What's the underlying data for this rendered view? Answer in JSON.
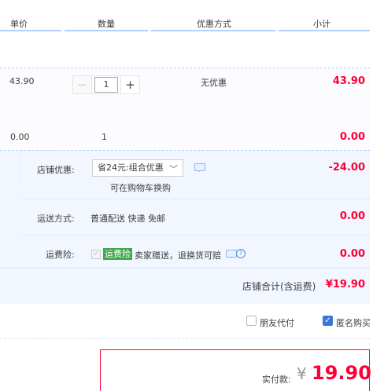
{
  "header": {
    "unit_price": "单价",
    "quantity": "数量",
    "discount": "优惠方式",
    "subtotal": "小计"
  },
  "item": {
    "price": "43.90",
    "quantity_value": "1",
    "discount_text": "无优惠",
    "subtotal": "43.90"
  },
  "row2": {
    "price": "0.00",
    "quantity": "1",
    "subtotal": "0.00"
  },
  "shop": {
    "coupon_label": "店铺优惠:",
    "coupon_select": "省24元:组合优惠",
    "coupon_hint": "可在购物车换购",
    "coupon_amount": "-24.00",
    "shipping_label": "运送方式:",
    "shipping_value": "普通配送 快递 免邮",
    "shipping_amount": "0.00",
    "insurance_label": "运费险:",
    "insurance_badge": "运费险",
    "insurance_text": "卖家赠送，退换货可赔",
    "insurance_amount": "0.00",
    "total_label": "店铺合计(含运费)",
    "total_amount": "¥19.90"
  },
  "options": {
    "friend_pay": "朋友代付",
    "friend_pay_checked": false,
    "anonymous": "匿名购买",
    "anonymous_checked": true
  },
  "payment": {
    "label": "实付款:",
    "currency": "¥",
    "amount": "19.90"
  },
  "colors": {
    "accent_red": "#ff0036",
    "header_line": "#b2d1ff",
    "shop_bg": "#f2f7ff",
    "checkbox_blue": "#3879d9",
    "insurance_green": "#3fa94b"
  },
  "icons": [
    "minus-icon",
    "plus-icon",
    "chevron-down-icon",
    "chat-icon",
    "help-icon",
    "check-icon"
  ]
}
